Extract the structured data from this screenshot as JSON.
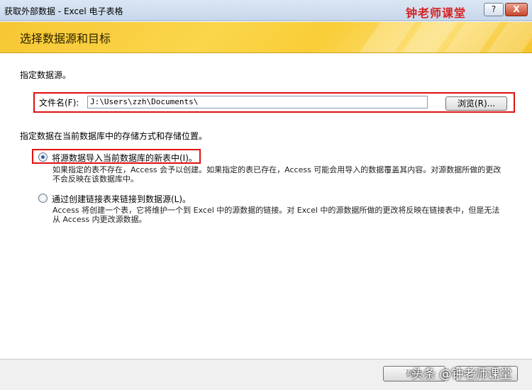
{
  "window": {
    "title": "获取外部数据 - Excel 电子表格",
    "logo_text": "钟老师课堂",
    "help_label": "?",
    "close_label": "X"
  },
  "banner": {
    "heading": "选择数据源和目标"
  },
  "source": {
    "prompt": "指定数据源。",
    "filename_label": "文件名(F):",
    "filename_value": "J:\\Users\\zzh\\Documents\\",
    "browse_label": "浏览(R)..."
  },
  "storage": {
    "prompt": "指定数据在当前数据库中的存储方式和存储位置。",
    "options": [
      {
        "label": "将源数据导入当前数据库的新表中(I)。",
        "description": "如果指定的表不存在，Access 会予以创建。如果指定的表已存在，Access 可能会用导入的数据覆盖其内容。对源数据所做的更改不会反映在该数据库中。",
        "selected": true
      },
      {
        "label": "通过创建链接表来链接到数据源(L)。",
        "description": "Access 将创建一个表，它将维护一个到 Excel 中的源数据的链接。对 Excel 中的源数据所做的更改将反映在链接表中，但是无法从 Access 内更改源数据。",
        "selected": false
      }
    ]
  },
  "footer": {
    "ok_label": "确定",
    "watermark": "头条 @钟老师课堂"
  }
}
